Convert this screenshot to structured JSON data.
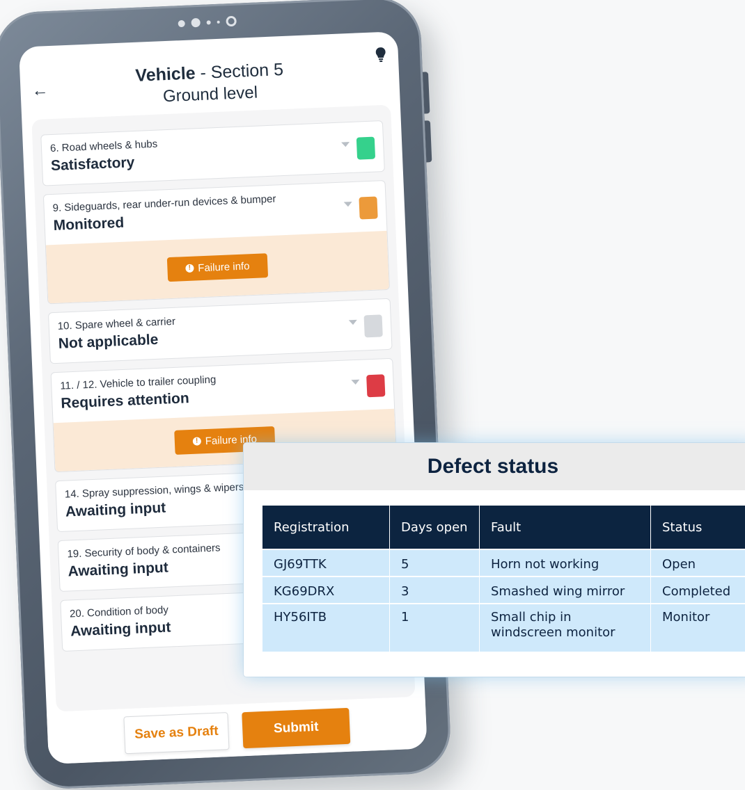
{
  "tablet": {
    "header": {
      "title_bold": "Vehicle",
      "title_rest": " - Section 5",
      "subtitle": "Ground level",
      "back_icon": "arrow-left-icon",
      "hint_icon": "lightbulb-icon"
    },
    "items": [
      {
        "label": "6. Road wheels & hubs",
        "status": "Satisfactory",
        "color": "#35d18c",
        "failure_info": null
      },
      {
        "label": "9. Sideguards, rear under-run devices & bumper",
        "status": "Monitored",
        "color": "#ec9a3a",
        "failure_info": "Failure info"
      },
      {
        "label": "10. Spare wheel & carrier",
        "status": "Not applicable",
        "color": "#d6d9dd",
        "failure_info": null
      },
      {
        "label": "11. / 12. Vehicle to trailer coupling",
        "status": "Requires attention",
        "color": "#dd3c45",
        "failure_info": "Failure info"
      },
      {
        "label": "14. Spray suppression, wings & wipers",
        "status": "Awaiting input",
        "color": "#d6d9dd",
        "failure_info": null
      },
      {
        "label": "19. Security of body & containers",
        "status": "Awaiting input",
        "color": "#d6d9dd",
        "failure_info": null
      },
      {
        "label": "20. Condition of body",
        "status": "Awaiting input",
        "color": "#d6d9dd",
        "failure_info": null
      }
    ],
    "footer": {
      "draft_label": "Save as Draft",
      "submit_label": "Submit"
    }
  },
  "defect_status": {
    "title": "Defect status",
    "columns": [
      "Registration",
      "Days open",
      "Fault",
      "Status"
    ],
    "rows": [
      [
        "GJ69TTK",
        "5",
        "Horn not working",
        "Open"
      ],
      [
        "KG69DRX",
        "3",
        "Smashed wing mirror",
        "Completed"
      ],
      [
        "HY56ITB",
        "1",
        "Small chip in windscreen monitor",
        "Monitor"
      ]
    ]
  },
  "colors": {
    "accent_orange": "#e5810f",
    "navy": "#0c2440",
    "row_blue": "#cfe9fb"
  }
}
